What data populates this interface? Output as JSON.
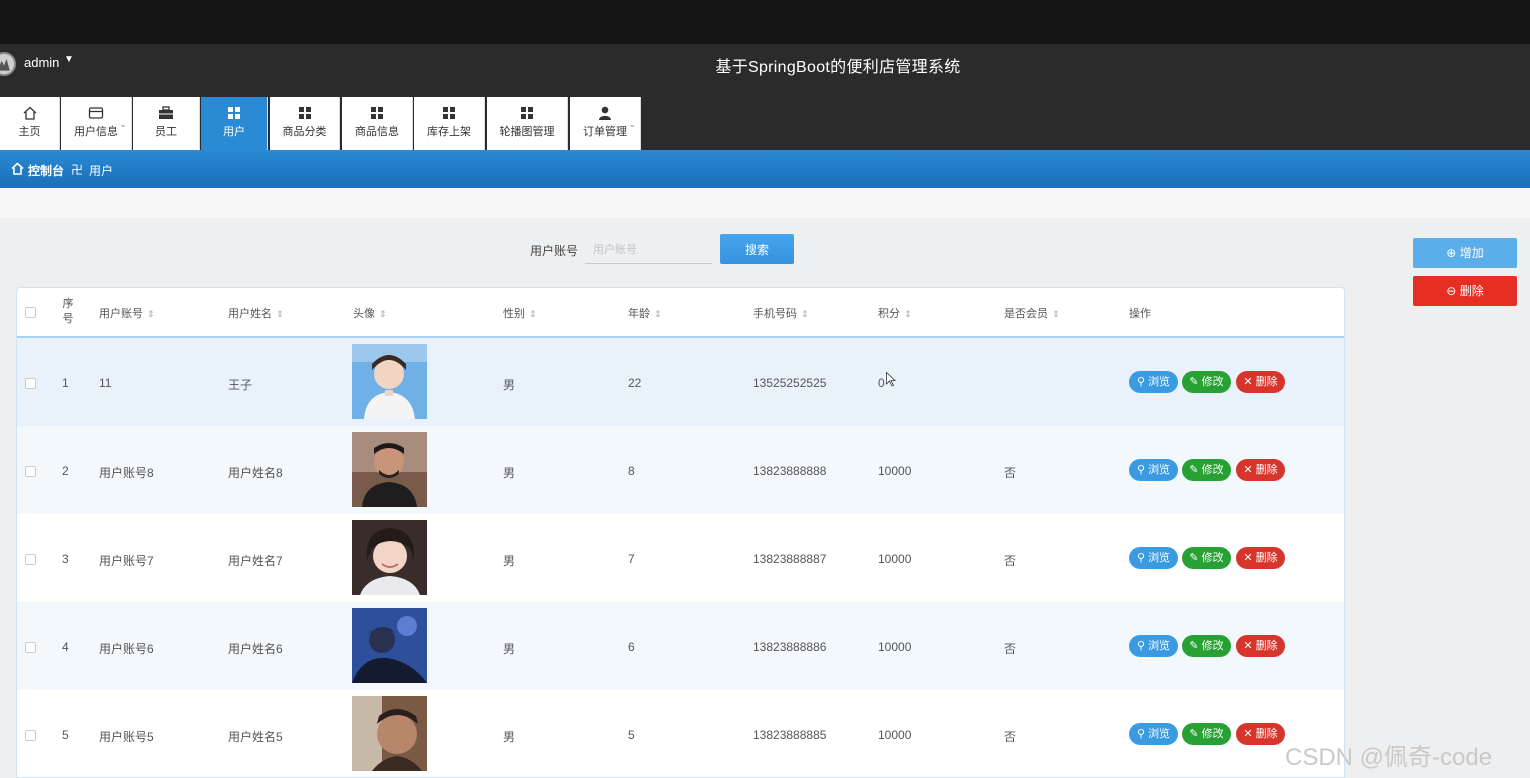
{
  "header": {
    "admin_name": "admin",
    "system_title": "基于SpringBoot的便利店管理系统"
  },
  "nav": [
    {
      "label": "主页",
      "icon": "home-icon",
      "dropdown": false
    },
    {
      "label": "用户信息",
      "icon": "wallet-icon",
      "dropdown": true
    },
    {
      "label": "员工",
      "icon": "briefcase-icon",
      "dropdown": false
    },
    {
      "label": "用户",
      "icon": "grid-icon",
      "dropdown": false,
      "active": true
    },
    {
      "label": "商品分类",
      "icon": "grid-icon",
      "dropdown": false
    },
    {
      "label": "商品信息",
      "icon": "grid-icon",
      "dropdown": false
    },
    {
      "label": "库存上架",
      "icon": "grid-icon",
      "dropdown": false
    },
    {
      "label": "轮播图管理",
      "icon": "grid-icon",
      "dropdown": false
    },
    {
      "label": "订单管理",
      "icon": "person-icon",
      "dropdown": true
    }
  ],
  "breadcrumb": {
    "home": "控制台",
    "separator": "卍",
    "current": "用户"
  },
  "search": {
    "label": "用户账号",
    "placeholder": "用户账号",
    "button": "搜索"
  },
  "actions": {
    "add": "增加",
    "delete": "删除"
  },
  "table": {
    "columns": [
      "序号",
      "用户账号",
      "用户姓名",
      "头像",
      "性别",
      "年龄",
      "手机号码",
      "积分",
      "是否会员",
      "操作"
    ],
    "rows": [
      {
        "seq": "1",
        "account": "11",
        "name": "王子",
        "gender": "男",
        "age": "22",
        "phone": "13525252525",
        "points": "0",
        "member": ""
      },
      {
        "seq": "2",
        "account": "用户账号8",
        "name": "用户姓名8",
        "gender": "男",
        "age": "8",
        "phone": "13823888888",
        "points": "10000",
        "member": "否"
      },
      {
        "seq": "3",
        "account": "用户账号7",
        "name": "用户姓名7",
        "gender": "男",
        "age": "7",
        "phone": "13823888887",
        "points": "10000",
        "member": "否"
      },
      {
        "seq": "4",
        "account": "用户账号6",
        "name": "用户姓名6",
        "gender": "男",
        "age": "6",
        "phone": "13823888886",
        "points": "10000",
        "member": "否"
      },
      {
        "seq": "5",
        "account": "用户账号5",
        "name": "用户姓名5",
        "gender": "男",
        "age": "5",
        "phone": "13823888885",
        "points": "10000",
        "member": "否"
      }
    ],
    "row_actions": {
      "view": "浏览",
      "edit": "修改",
      "delete": "删除"
    }
  },
  "watermark": "CSDN @佩奇-code",
  "colors": {
    "primary": "#2a8ad4",
    "view": "#3a9be0",
    "edit": "#27a133",
    "danger": "#d9342b"
  }
}
